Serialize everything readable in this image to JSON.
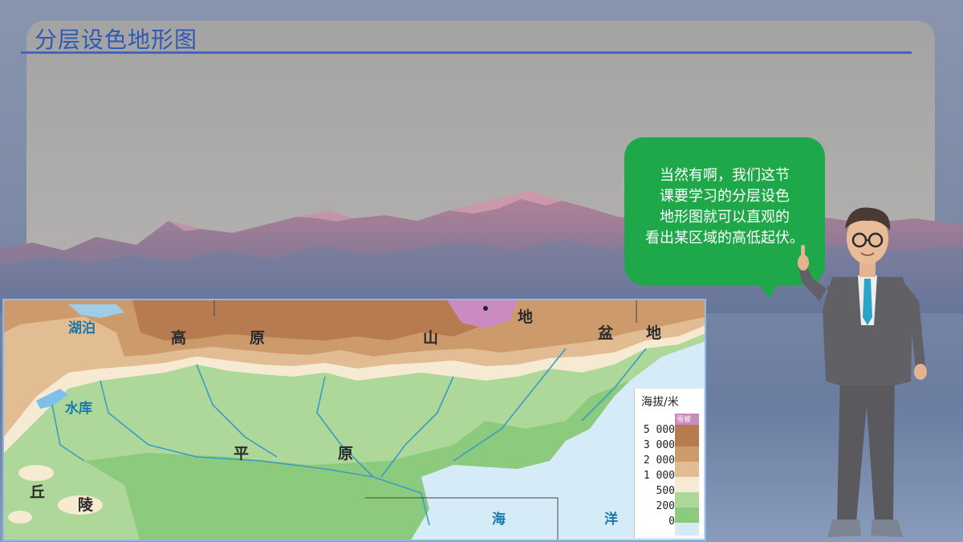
{
  "slide": {
    "title": "分层设色地形图"
  },
  "speech_bubble": {
    "lines": [
      "当然有啊，我们这节",
      "课要学习的分层设色",
      "地形图就可以直观的",
      "看出某区域的高低起伏。"
    ]
  },
  "map": {
    "labels": {
      "lake": "湖泊",
      "reservoir": "水库",
      "gao": "高",
      "yuan1": "原",
      "shan": "山",
      "di1": "地",
      "pen": "盆",
      "di2": "地",
      "ping": "平",
      "yuan2": "原",
      "qiu": "丘",
      "ling": "陵",
      "hai": "海",
      "yang": "洋"
    },
    "legend": {
      "title": "海拔/米",
      "snow_label": "雪被",
      "levels": [
        "5 000",
        "3 000",
        "2 000",
        "1 000",
        "500",
        "200",
        "0"
      ],
      "colors": [
        "#c98bc0",
        "#b67b4f",
        "#cd9a6c",
        "#e2bd93",
        "#f6ebd2",
        "#aed89a",
        "#8ccb7d",
        "#d5ecf8"
      ]
    }
  }
}
